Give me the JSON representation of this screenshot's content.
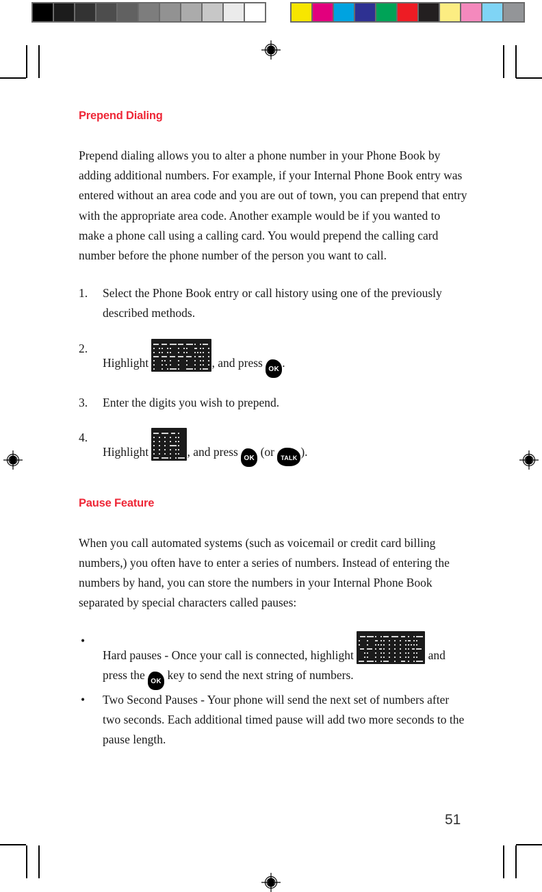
{
  "document": {
    "page_number": "51"
  },
  "calibration": {
    "grayscale_label": "grayscale-calibration-bar",
    "color_label": "color-calibration-bar",
    "grayscale_swatches": [
      "#000000",
      "#1c1c1c",
      "#333333",
      "#4d4d4d",
      "#616161",
      "#7d7d7d",
      "#929292",
      "#ababab",
      "#c7c7c7",
      "#ebebeb",
      "#ffffff"
    ],
    "color_swatches": [
      "#f7e600",
      "#e2007d",
      "#00a3e0",
      "#2e3192",
      "#00a357",
      "#ed1c24",
      "#231f20",
      "#fced82",
      "#f489bd",
      "#7fd4f5",
      "#939598"
    ]
  },
  "sections": [
    {
      "id": "prepend-dialing",
      "heading": "Prepend Dialing",
      "paragraph": "Prepend dialing allows you to alter a phone number in your Phone Book by adding additional numbers. For example, if your Internal Phone Book entry was entered without an area code and you are out of town, you can prepend that entry with the appropriate area code. Another example would be if you wanted to make a phone call using a calling card. You would prepend the calling card number before the phone number of the person you want to call.",
      "steps": [
        {
          "marker": "1.",
          "text": "Select the Phone Book entry or call history using one of the previously described methods."
        },
        {
          "marker": "2.",
          "text_before": "Highlight",
          "lcd_label": "Prepend",
          "text_middle": ", and press",
          "key1": "OK",
          "text_after": "."
        },
        {
          "marker": "3.",
          "text": "Enter the digits you wish to prepend."
        },
        {
          "marker": "4.",
          "text_before": "Highlight",
          "lcd_label": "Dial",
          "text_middle": ", and press",
          "key1": "OK",
          "text_between": "(or",
          "key2": "TALK",
          "text_after": ")."
        }
      ]
    },
    {
      "id": "pause-feature",
      "heading": "Pause Feature",
      "paragraph": "When you call automated systems (such as voicemail or credit card billing numbers,) you often have to enter a series of numbers. Instead of entering the numbers by hand, you can store the numbers in your Internal Phone Book separated by special characters called pauses:",
      "bullets": [
        {
          "marker": "•",
          "text_before": "Hard pauses - Once your call is connected, highlight",
          "lcd_label": "Send Tone",
          "text_middle": "and press the",
          "key1": "OK",
          "text_after": "key to send the next string of numbers."
        },
        {
          "marker": "•",
          "text": "Two Second Pauses - Your phone will send the next set of numbers after two seconds. Each additional timed pause will add two more seconds to the pause length."
        }
      ]
    }
  ]
}
